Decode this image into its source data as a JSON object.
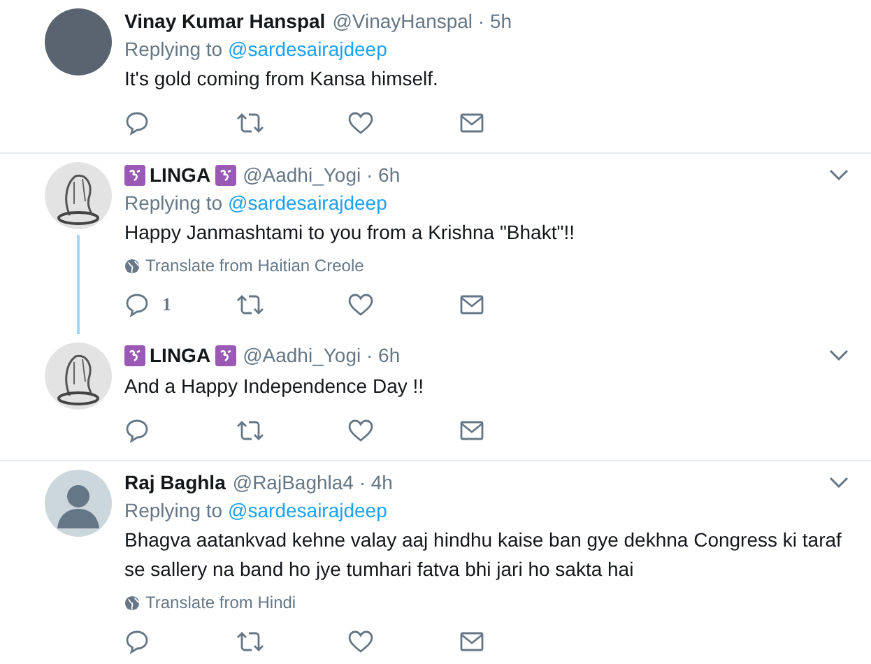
{
  "tweets": [
    {
      "kind": "photo",
      "name": "Vinay Kumar Hanspal",
      "emoji_badges": false,
      "handle": "@VinayHanspal · 5h",
      "menu_caret": false,
      "replying_label": "Replying to",
      "replying_to": "@sardesairajdeep",
      "text": "It's gold coming from Kansa himself.",
      "thread_continues": false
    },
    {
      "kind": "sketch",
      "name": "LINGA",
      "emoji_badges": true,
      "handle": "@Aadhi_Yogi · 6h",
      "menu_caret": true,
      "replying_label": "Replying to",
      "replying_to": "@sardesairajdeep",
      "text": "Happy Janmashtami to you from a Krishna \"Bhakt\"!!",
      "translate": "Translate from Haitian Creole",
      "reply_count": "1",
      "thread_continues": true
    },
    {
      "kind": "sketch",
      "name": "LINGA",
      "emoji_badges": true,
      "handle": "@Aadhi_Yogi · 6h",
      "menu_caret": true,
      "text": "And a Happy Independence Day !!",
      "thread_continues": false
    },
    {
      "kind": "default",
      "name": "Raj Baghla",
      "emoji_badges": false,
      "handle": "@RajBaghla4 · 4h",
      "menu_caret": true,
      "replying_label": "Replying to",
      "replying_to": "@sardesairajdeep",
      "text": "Bhagva aatankvad kehne valay aaj hindhu kaise ban gye dekhna Congress ki taraf se sallery na band ho jye tumhari fatva bhi jari ho sakta hai",
      "translate": "Translate from Hindi",
      "thread_continues": false
    }
  ]
}
